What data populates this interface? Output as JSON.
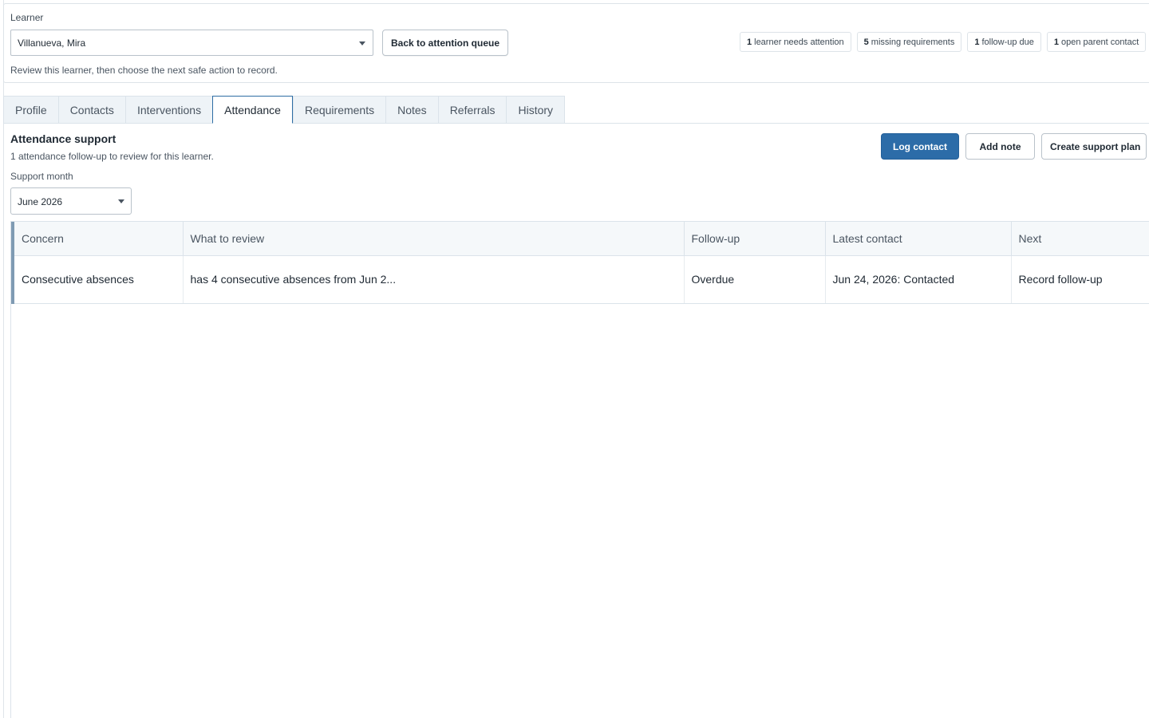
{
  "header": {
    "learner_label": "Learner",
    "learner_value": "Villanueva, Mira",
    "back_label": "Back to attention queue",
    "hint": "Review this learner, then choose the next safe action to record.",
    "chips": [
      {
        "count": "1",
        "label": "learner needs attention"
      },
      {
        "count": "5",
        "label": "missing requirements"
      },
      {
        "count": "1",
        "label": "follow-up due"
      },
      {
        "count": "1",
        "label": "open parent contact"
      }
    ]
  },
  "tabs": [
    {
      "label": "Profile"
    },
    {
      "label": "Contacts"
    },
    {
      "label": "Interventions"
    },
    {
      "label": "Attendance",
      "active": true
    },
    {
      "label": "Requirements"
    },
    {
      "label": "Notes"
    },
    {
      "label": "Referrals"
    },
    {
      "label": "History"
    }
  ],
  "section": {
    "title": "Attendance support",
    "subtitle": "1 attendance follow-up to review for this learner.",
    "month_label": "Support month",
    "month_value": "June 2026"
  },
  "actions": {
    "log_contact": "Log contact",
    "add_note": "Add note",
    "create_plan": "Create support plan"
  },
  "table": {
    "columns": [
      "Concern",
      "What to review",
      "Follow-up",
      "Latest contact",
      "Next"
    ],
    "rows": [
      [
        "Consecutive absences",
        "has 4 consecutive absences from Jun 2...",
        "Overdue",
        "Jun 24, 2026: Contacted",
        "Record follow-up"
      ]
    ]
  },
  "colors": {
    "accent": "#2c6ca8",
    "row_marker": "#7f9bb3"
  }
}
